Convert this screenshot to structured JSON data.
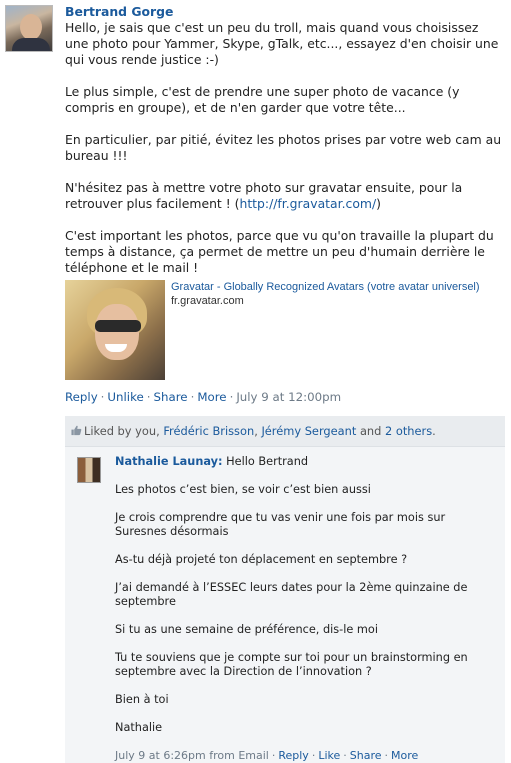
{
  "post": {
    "author": "Bertrand Gorge",
    "paragraphs": [
      "Hello, je sais que c'est un peu du troll, mais quand vous choisissez une photo pour Yammer, Skype, gTalk, etc..., essayez d'en choisir une qui vous rende justice :-)",
      "Le plus simple, c'est de prendre une super photo de vacance (y compris en groupe), et de n'en garder que votre tête...",
      "En particulier, par pitié, évitez les photos prises par votre web cam au bureau !!!",
      "C'est important les photos, parce que vu qu'on travaille la plupart du temps à distance, ça permet de mettre un peu d'humain derrière le téléphone et le mail !"
    ],
    "para4_prefix": "N'hésitez pas à mettre votre photo sur gravatar ensuite, pour la retrouver plus facilement ! (",
    "para4_link": "http://fr.gravatar.com/",
    "para4_suffix": ")"
  },
  "attachment": {
    "title": "Gravatar - Globally Recognized Avatars (votre avatar universel)",
    "domain": "fr.gravatar.com"
  },
  "actions": {
    "reply": "Reply",
    "unlike": "Unlike",
    "share": "Share",
    "more": "More",
    "timestamp": "July 9 at 12:00pm",
    "dot": "·"
  },
  "likes": {
    "prefix": "Liked by you, ",
    "user1": "Frédéric Brisson",
    "comma": ", ",
    "user2": "Jérémy Sergeant",
    "and": " and ",
    "others": "2 others",
    "period": "."
  },
  "reply": {
    "author": "Nathalie Launay:",
    "greeting": " Hello Bertrand",
    "paragraphs": [
      "Les photos c’est bien, se voir c’est bien aussi",
      "Je crois comprendre que tu vas venir une fois par mois sur Suresnes désormais",
      "As-tu déjà projeté ton déplacement en septembre ?",
      "J’ai demandé à l’ESSEC leurs dates pour la 2ème quinzaine de septembre",
      "Si tu as une semaine de préférence, dis-le moi",
      "Tu te souviens que je compte sur toi pour un brainstorming en septembre avec la Direction de l’innovation ?",
      "Bien à toi",
      "Nathalie"
    ],
    "meta": {
      "timestamp": "July 9 at 6:26pm from Email",
      "reply": "Reply",
      "like": "Like",
      "share": "Share",
      "more": "More",
      "dot": "·"
    }
  },
  "colors": {
    "link": "#1b5a9c",
    "muted": "#6d7a87",
    "likes_bg": "#e9ecef",
    "reply_bg": "#f3f5f7"
  },
  "icons": {
    "avatar": "user-photo",
    "thumb": "thumbs-up-icon"
  }
}
